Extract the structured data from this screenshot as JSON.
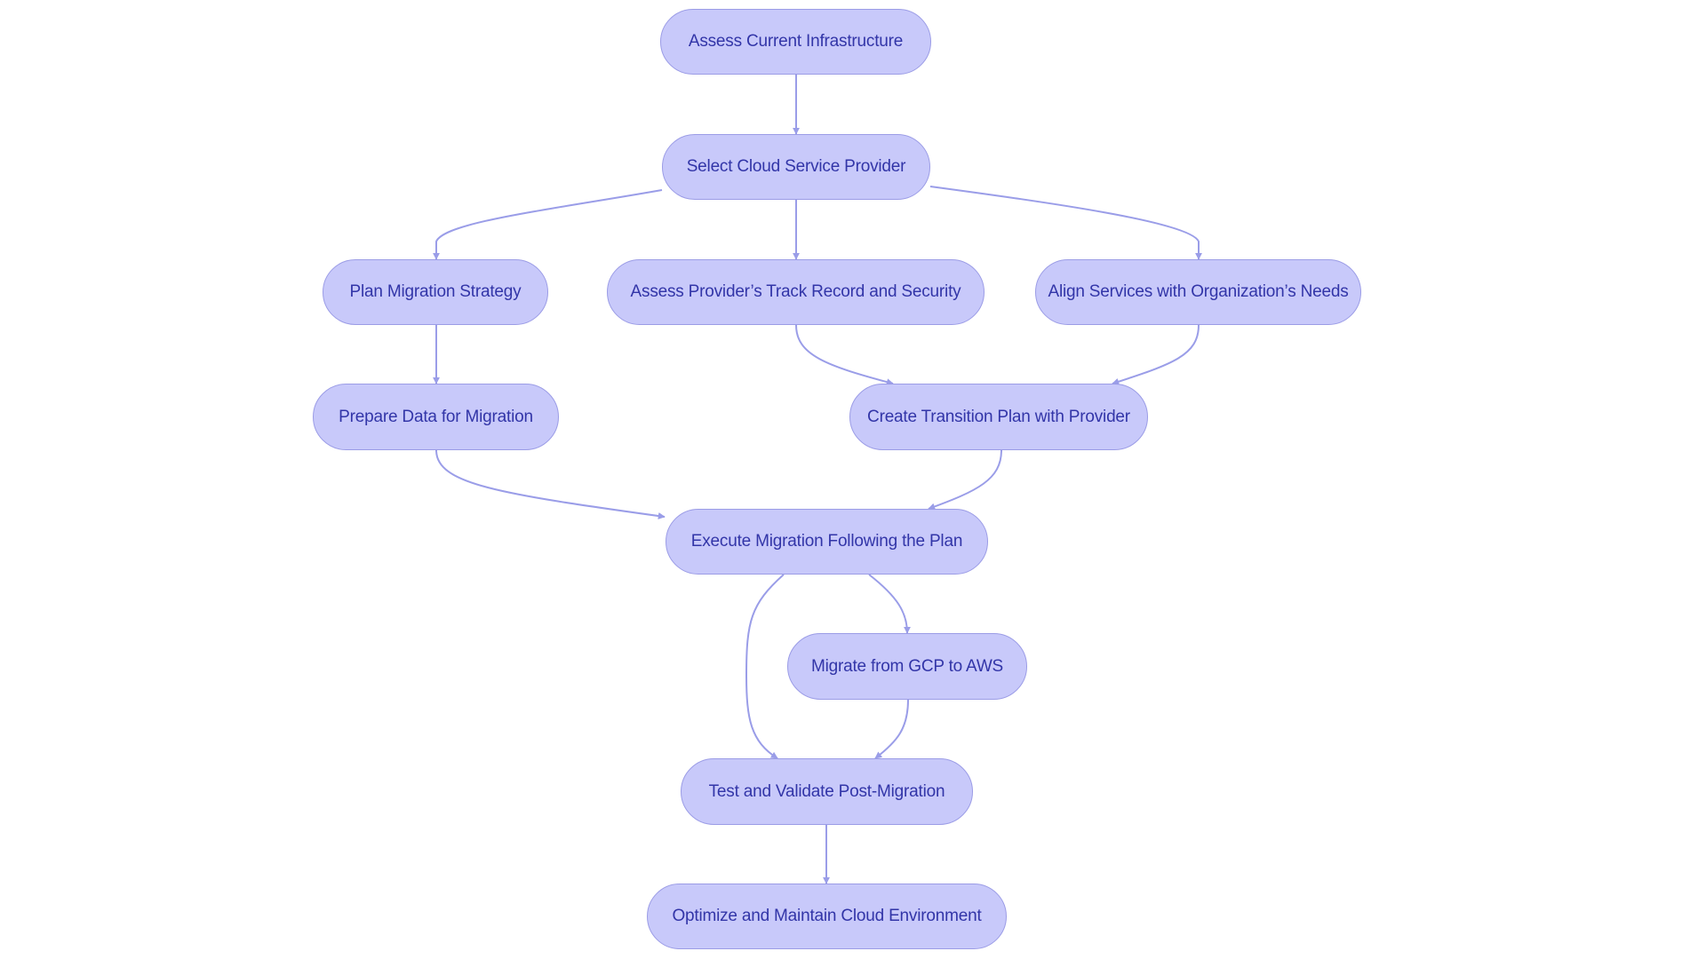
{
  "diagram": {
    "type": "flowchart",
    "colors": {
      "node_fill": "#c8c9fa",
      "node_border": "#9b9ce6",
      "text": "#3235a8",
      "edge": "#9a9de8"
    },
    "nodes": [
      {
        "id": "assess_infra",
        "label": "Assess Current Infrastructure"
      },
      {
        "id": "select_csp",
        "label": "Select Cloud Service Provider"
      },
      {
        "id": "plan_strategy",
        "label": "Plan Migration Strategy"
      },
      {
        "id": "assess_provider",
        "label": "Assess Provider’s Track Record and Security"
      },
      {
        "id": "align_services",
        "label": "Align Services with Organization’s Needs"
      },
      {
        "id": "prepare_data",
        "label": "Prepare Data for Migration"
      },
      {
        "id": "create_transition",
        "label": "Create Transition Plan with Provider"
      },
      {
        "id": "execute_migration",
        "label": "Execute Migration Following the Plan"
      },
      {
        "id": "migrate_gcp_aws",
        "label": "Migrate from GCP to AWS"
      },
      {
        "id": "test_validate",
        "label": "Test and Validate Post-Migration"
      },
      {
        "id": "optimize_maintain",
        "label": "Optimize and Maintain Cloud Environment"
      }
    ],
    "edges": [
      {
        "from": "assess_infra",
        "to": "select_csp"
      },
      {
        "from": "select_csp",
        "to": "plan_strategy"
      },
      {
        "from": "select_csp",
        "to": "assess_provider"
      },
      {
        "from": "select_csp",
        "to": "align_services"
      },
      {
        "from": "plan_strategy",
        "to": "prepare_data"
      },
      {
        "from": "assess_provider",
        "to": "create_transition"
      },
      {
        "from": "align_services",
        "to": "create_transition"
      },
      {
        "from": "prepare_data",
        "to": "execute_migration"
      },
      {
        "from": "create_transition",
        "to": "execute_migration"
      },
      {
        "from": "execute_migration",
        "to": "test_validate"
      },
      {
        "from": "execute_migration",
        "to": "migrate_gcp_aws"
      },
      {
        "from": "migrate_gcp_aws",
        "to": "test_validate"
      },
      {
        "from": "test_validate",
        "to": "optimize_maintain"
      }
    ]
  }
}
